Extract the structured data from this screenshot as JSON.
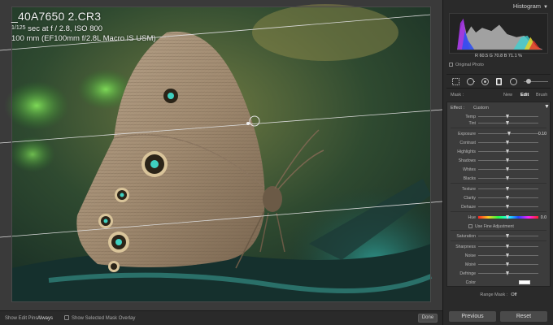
{
  "photo_info": {
    "filename": "_40A7650 2.CR3",
    "exposure_denominator": "125",
    "exposure_rest": "sec at f / 2.8, ISO 800",
    "lens": "100 mm (EF100mm f/2.8L Macro IS USM)"
  },
  "toolbar": {
    "show_edit_pins_label": "Show Edit Pins :",
    "show_edit_pins_value": "Always",
    "mask_overlay_label": "Show Selected Mask Overlay",
    "done_label": "Done"
  },
  "histogram": {
    "title": "Histogram",
    "readout": "R  60.5  G  70.8  B  71.1 %",
    "original_photo_label": "Original Photo"
  },
  "mask": {
    "label": "Mask :",
    "new_label": "New",
    "edit_label": "Edit",
    "brush_label": "Brush"
  },
  "effect": {
    "label": "Effect :",
    "value": "Custom"
  },
  "sliders": [
    {
      "label": "Temp",
      "value": ""
    },
    {
      "label": "Tint",
      "value": ""
    },
    {
      "label": "Exposure",
      "value": "0.10"
    },
    {
      "label": "Contrast",
      "value": ""
    },
    {
      "label": "Highlights",
      "value": ""
    },
    {
      "label": "Shadows",
      "value": ""
    },
    {
      "label": "Whites",
      "value": ""
    },
    {
      "label": "Blacks",
      "value": ""
    },
    {
      "label": "Texture",
      "value": ""
    },
    {
      "label": "Clarity",
      "value": ""
    },
    {
      "label": "Dehaze",
      "value": ""
    },
    {
      "label": "Hue",
      "value": "0.0"
    },
    {
      "label": "Saturation",
      "value": ""
    },
    {
      "label": "Sharpness",
      "value": ""
    },
    {
      "label": "Noise",
      "value": ""
    },
    {
      "label": "Moiré",
      "value": ""
    },
    {
      "label": "Defringe",
      "value": ""
    }
  ],
  "fine_adjustment_label": "Use Fine Adjustment",
  "color_label": "Color",
  "range_mask": {
    "label": "Range Mask :",
    "value": "Off"
  },
  "buttons": {
    "previous": "Previous",
    "reset": "Reset"
  }
}
